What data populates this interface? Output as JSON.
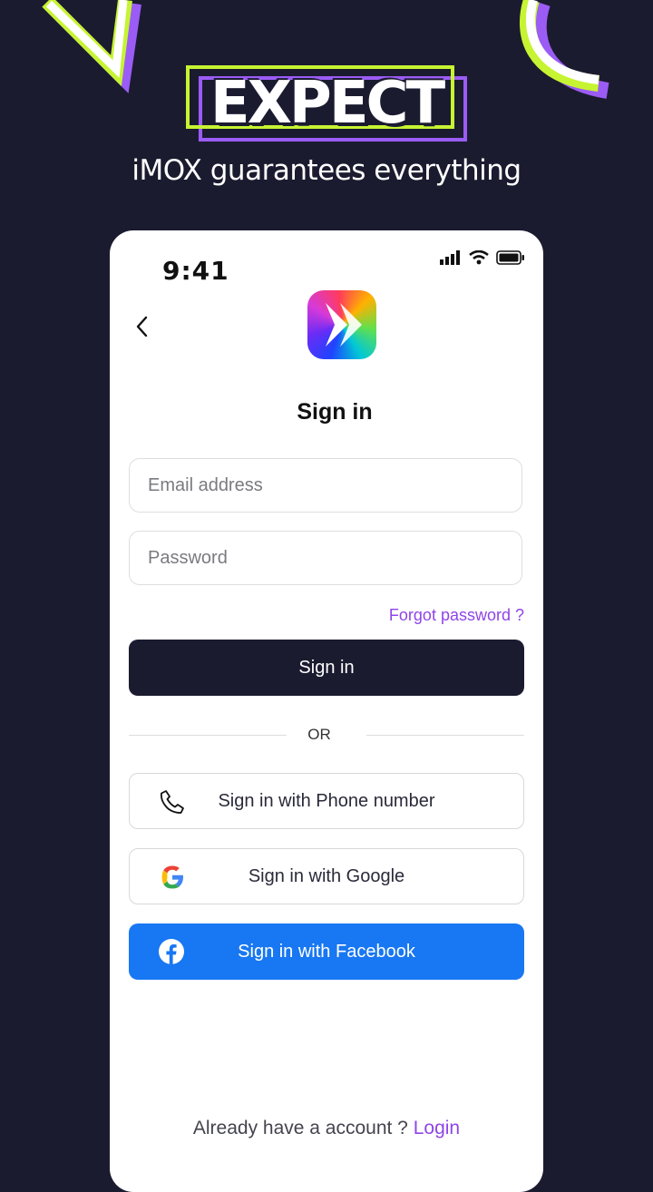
{
  "hero": {
    "word": "EXPECT",
    "tagline": "iMOX guarantees everything"
  },
  "status": {
    "time": "9:41"
  },
  "screen": {
    "title": "Sign in"
  },
  "form": {
    "email_placeholder": "Email address",
    "password_placeholder": "Password",
    "forgot_label": "Forgot password ?",
    "submit_label": "Sign in"
  },
  "divider": {
    "label": "OR"
  },
  "social": {
    "phone_label": "Sign in with Phone number",
    "google_label": "Sign in with Google",
    "facebook_label": "Sign in with Facebook"
  },
  "footer": {
    "prompt": "Already have a account ?",
    "link": "Login"
  },
  "colors": {
    "background": "#1b1b30",
    "accent_lime": "#c6f432",
    "accent_purple": "#9b5cf6",
    "facebook_blue": "#1877f2",
    "link_purple": "#8f45e8"
  }
}
